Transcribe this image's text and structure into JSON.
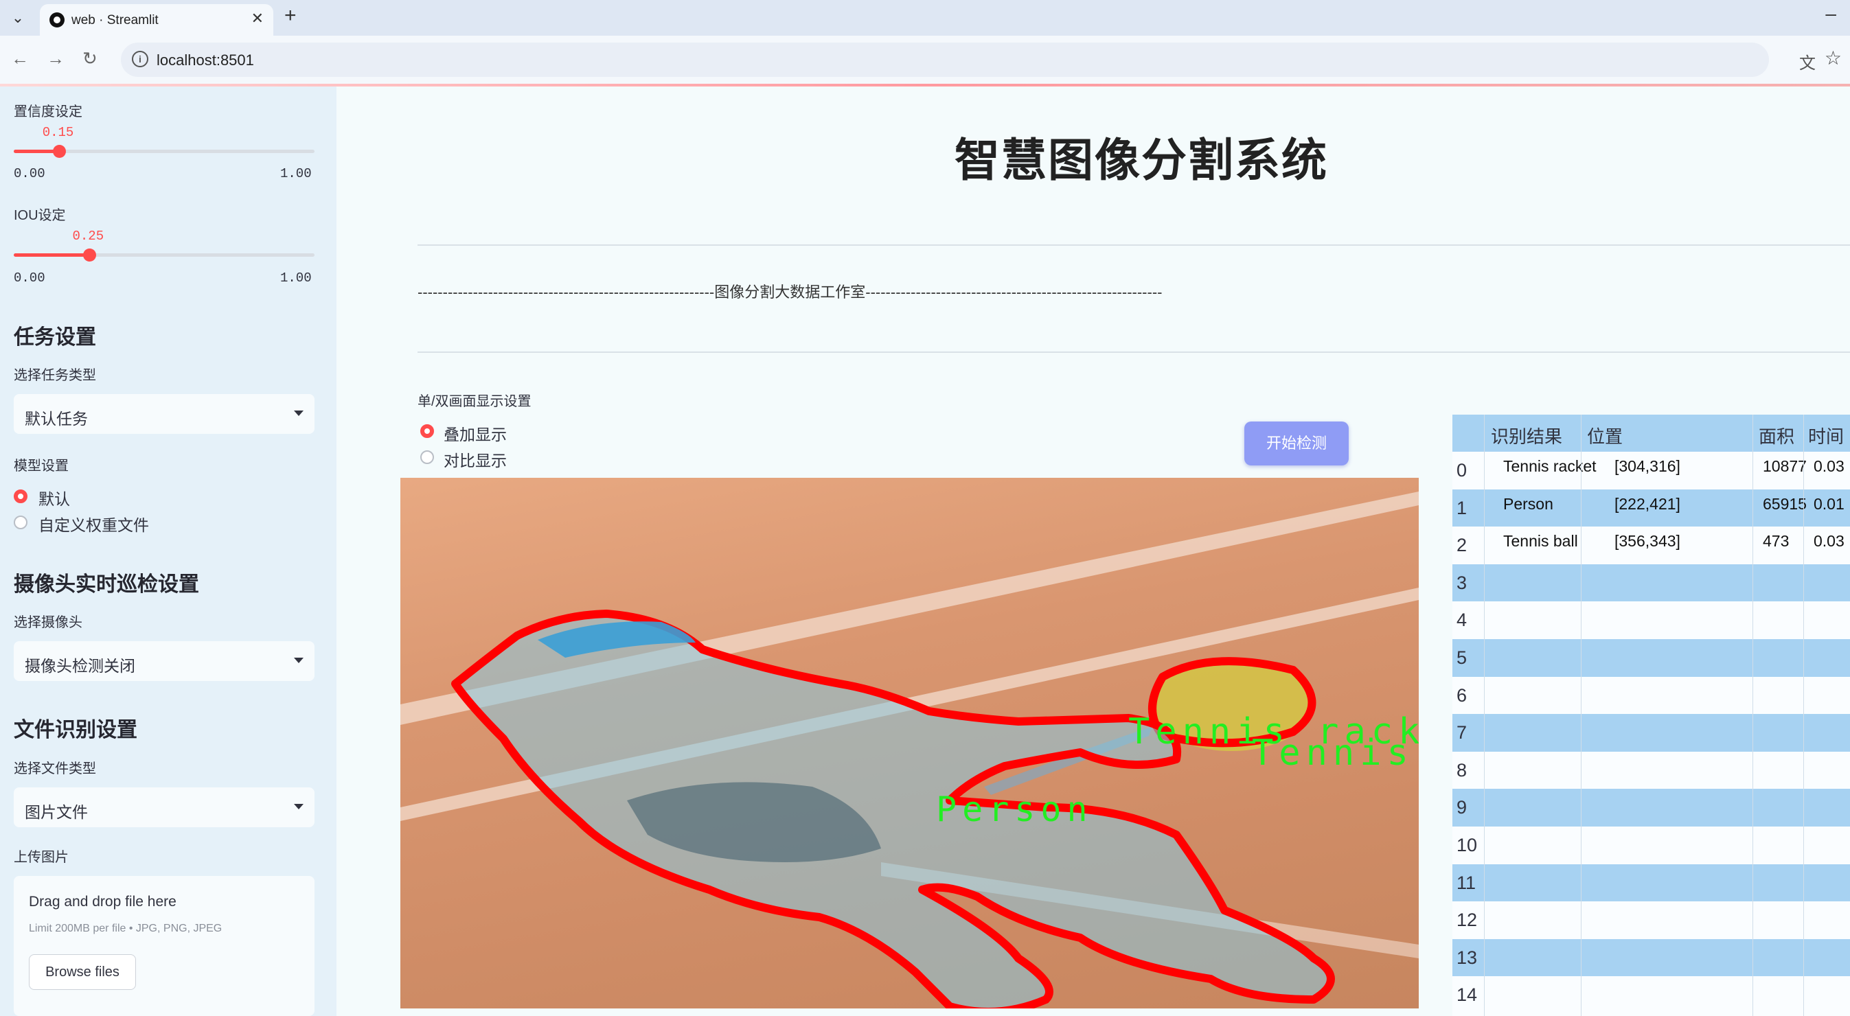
{
  "browser": {
    "tab_title": "web · Streamlit",
    "url": "localhost:8501"
  },
  "sidebar": {
    "confidence": {
      "label": "置信度设定",
      "value": 0.15,
      "value_text": "0.15",
      "min": "0.00",
      "max": "1.00"
    },
    "iou": {
      "label": "IOU设定",
      "value": 0.25,
      "value_text": "0.25",
      "min": "0.00",
      "max": "1.00"
    },
    "task_section": "任务设置",
    "task_type_label": "选择任务类型",
    "task_type_value": "默认任务",
    "model_label": "模型设置",
    "model_options": [
      "默认",
      "自定义权重文件"
    ],
    "model_selected": 0,
    "camera_section": "摄像头实时巡检设置",
    "camera_label": "选择摄像头",
    "camera_value": "摄像头检测关闭",
    "file_section": "文件识别设置",
    "file_type_label": "选择文件类型",
    "file_type_value": "图片文件",
    "upload_label": "上传图片",
    "upload_title": "Drag and drop file here",
    "upload_limit": "Limit 200MB per file • JPG, PNG, JPEG",
    "upload_button": "Browse files"
  },
  "main": {
    "title": "智慧图像分割系统",
    "divider_text": "-----------------------------------------------------------图像分割大数据工作室-----------------------------------------------------------",
    "display_mode_label": "单/双画面显示设置",
    "display_options": [
      "叠加显示",
      "对比显示"
    ],
    "display_selected": 0,
    "detect_button": "开始检测",
    "image_labels": {
      "racket": "Tennis racket",
      "ball": "Tennis ball",
      "person": "Person"
    }
  },
  "results_table": {
    "columns": [
      "识别结果",
      "位置",
      "面积",
      "时间"
    ],
    "rows": [
      {
        "index": "0",
        "result": "Tennis racket",
        "position": "[304,316]",
        "area": "10877",
        "time": "0.03"
      },
      {
        "index": "1",
        "result": "Person",
        "position": "[222,421]",
        "area": "65915",
        "time": "0.01"
      },
      {
        "index": "2",
        "result": "Tennis ball",
        "position": "[356,343]",
        "area": "473",
        "time": "0.03"
      },
      {
        "index": "3"
      },
      {
        "index": "4"
      },
      {
        "index": "5"
      },
      {
        "index": "6"
      },
      {
        "index": "7"
      },
      {
        "index": "8"
      },
      {
        "index": "9"
      },
      {
        "index": "10"
      },
      {
        "index": "11"
      },
      {
        "index": "12"
      },
      {
        "index": "13"
      },
      {
        "index": "14"
      }
    ]
  },
  "colors": {
    "accent": "#ff4b4b",
    "button": "#8f9cf5",
    "table_stripe": "#a7d2f2",
    "sidebar_bg": "#e5f1f9",
    "mask_outline": "#ff0000",
    "label_text": "#22ee22"
  }
}
